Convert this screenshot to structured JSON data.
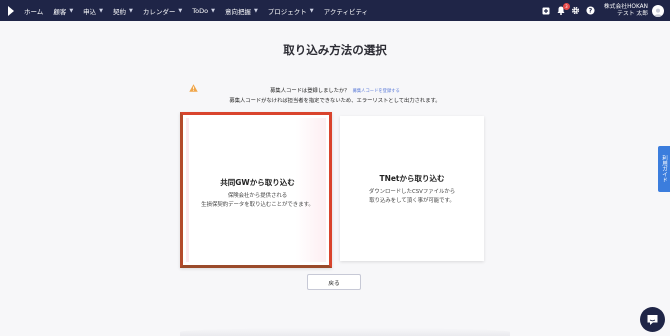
{
  "nav": {
    "items": [
      {
        "label": "ホーム",
        "dropdown": false
      },
      {
        "label": "顧客",
        "dropdown": true
      },
      {
        "label": "申込",
        "dropdown": true
      },
      {
        "label": "契約",
        "dropdown": true
      },
      {
        "label": "カレンダー",
        "dropdown": true
      },
      {
        "label": "ToDo",
        "dropdown": true
      },
      {
        "label": "意向把握",
        "dropdown": true
      },
      {
        "label": "プロジェクト",
        "dropdown": true
      },
      {
        "label": "アクティビティ",
        "dropdown": false
      }
    ],
    "notification_count": "3",
    "user_company": "株式会社HOKAN",
    "user_name": "テスト 太郎"
  },
  "page": {
    "title": "取り込み方法の選択",
    "notice_line1": "募集人コードは登録しましたか？",
    "notice_link": "募集人コードを登録する",
    "notice_line2": "募集人コードがなければ担当者を指定できないため、エラーリストとして出力されます。"
  },
  "options": [
    {
      "title": "共同GWから取り込む",
      "desc1": "保険会社から提供される",
      "desc2": "生損保契約データを取り込むことができます。"
    },
    {
      "title": "TNetから取り込む",
      "desc1": "ダウンロードしたCSVファイルから",
      "desc2": "取り込みをして頂く事が可能です。"
    }
  ],
  "back_label": "戻る",
  "side_tab_label": "利用ガイド",
  "colors": {
    "nav_bg": "#1f2547",
    "highlight": "#d9442d",
    "link": "#5a7ad8",
    "side_tab": "#3b7ddd"
  }
}
